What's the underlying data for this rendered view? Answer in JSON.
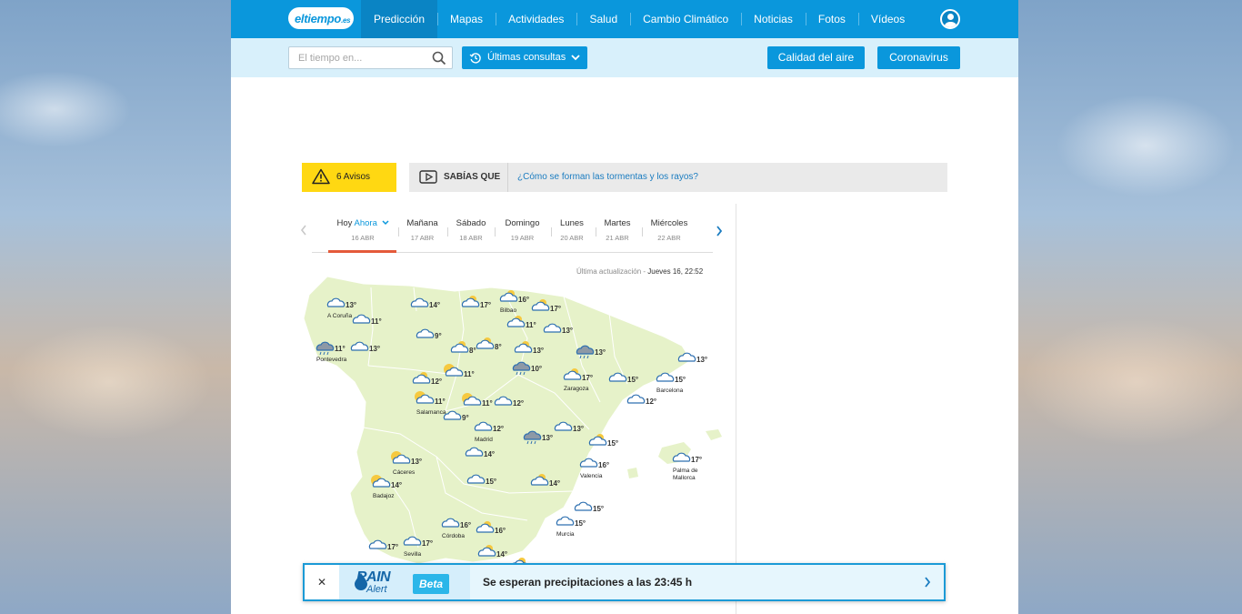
{
  "nav": {
    "logo": {
      "main": "eltiempo",
      "suffix": ".es"
    },
    "items": [
      {
        "label": "Predicción",
        "active": true
      },
      {
        "label": "Mapas"
      },
      {
        "label": "Actividades"
      },
      {
        "label": "Salud"
      },
      {
        "label": "Cambio Climático"
      },
      {
        "label": "Noticias"
      },
      {
        "label": "Fotos"
      },
      {
        "label": "Vídeos"
      }
    ],
    "user_icon": "user-icon"
  },
  "subbar": {
    "search_placeholder": "El tiempo en...",
    "recent_label": "Últimas consultas",
    "air_quality": "Calidad del aire",
    "coronavirus": "Coronavirus"
  },
  "alerts": {
    "avisos_label": "6 Avisos",
    "sabias_tag": "SABÍAS QUE",
    "sabias_link": "¿Cómo se forman las tormentas y los rayos?"
  },
  "days": [
    {
      "name": "Hoy",
      "now": "Ahora",
      "date": "16 ABR",
      "active": true
    },
    {
      "name": "Mañana",
      "date": "17 ABR"
    },
    {
      "name": "Sábado",
      "date": "18 ABR"
    },
    {
      "name": "Domingo",
      "date": "19 ABR"
    },
    {
      "name": "Lunes",
      "date": "20 ABR"
    },
    {
      "name": "Martes",
      "date": "21 ABR"
    },
    {
      "name": "Miércoles",
      "date": "22 ABR"
    }
  ],
  "update": {
    "label": "Última actualización -",
    "value": "Jueves 16, 22:52"
  },
  "map": {
    "colors": {
      "land": "#e6f2c9",
      "border": "#ffffff",
      "sea": "#ffffff"
    },
    "markers": [
      {
        "temp": "13°",
        "city": "A Coruña",
        "icon": "cloud-icon"
      },
      {
        "temp": "14°",
        "icon": "cloud-icon"
      },
      {
        "temp": "17°",
        "icon": "cloud-sun-icon"
      },
      {
        "temp": "16°",
        "city": "Bilbao",
        "icon": "cloud-sun-icon"
      },
      {
        "temp": "17°",
        "icon": "cloud-sun-icon"
      },
      {
        "temp": "11°",
        "icon": "cloud-sun-icon"
      },
      {
        "temp": "11°",
        "icon": "cloud-icon"
      },
      {
        "temp": "13°",
        "icon": "cloud-icon"
      },
      {
        "temp": "9°",
        "icon": "cloud-icon"
      },
      {
        "temp": "11°",
        "city": "Pontevedra",
        "icon": "rain-cloud-icon"
      },
      {
        "temp": "13°",
        "icon": "cloud-icon"
      },
      {
        "temp": "8°",
        "icon": "cloud-sun-icon"
      },
      {
        "temp": "8°",
        "icon": "cloud-sun-icon"
      },
      {
        "temp": "13°",
        "icon": "cloud-sun-icon"
      },
      {
        "temp": "13°",
        "icon": "rain-cloud-icon"
      },
      {
        "temp": "13°",
        "icon": "cloud-icon"
      },
      {
        "temp": "10°",
        "icon": "rain-cloud-icon"
      },
      {
        "temp": "11°",
        "icon": "moon-cloud-icon"
      },
      {
        "temp": "12°",
        "icon": "cloud-sun-icon"
      },
      {
        "temp": "17°",
        "city": "Zaragoza",
        "icon": "cloud-sun-icon"
      },
      {
        "temp": "15°",
        "icon": "cloud-icon"
      },
      {
        "temp": "15°",
        "city": "Barcelona",
        "icon": "cloud-icon"
      },
      {
        "temp": "12°",
        "icon": "cloud-icon"
      },
      {
        "temp": "11°",
        "city": "Salamanca",
        "icon": "moon-cloud-icon"
      },
      {
        "temp": "11°",
        "icon": "moon-cloud-icon"
      },
      {
        "temp": "12°",
        "icon": "cloud-icon"
      },
      {
        "temp": "9°",
        "icon": "cloud-icon"
      },
      {
        "temp": "12°",
        "city": "Madrid",
        "icon": "cloud-icon"
      },
      {
        "temp": "13°",
        "icon": "rain-cloud-icon"
      },
      {
        "temp": "13°",
        "icon": "cloud-icon"
      },
      {
        "temp": "15°",
        "icon": "cloud-sun-icon"
      },
      {
        "temp": "14°",
        "icon": "cloud-icon"
      },
      {
        "temp": "13°",
        "city": "Cáceres",
        "icon": "moon-cloud-icon"
      },
      {
        "temp": "16°",
        "city": "Valencia",
        "icon": "cloud-icon"
      },
      {
        "temp": "17°",
        "city": "Palma de\nMallorca",
        "icon": "cloud-icon"
      },
      {
        "temp": "14°",
        "city": "Badajoz",
        "icon": "moon-cloud-icon"
      },
      {
        "temp": "15°",
        "icon": "cloud-icon"
      },
      {
        "temp": "14°",
        "icon": "cloud-sun-icon"
      },
      {
        "temp": "15°",
        "icon": "cloud-icon"
      },
      {
        "temp": "15°",
        "city": "Murcia",
        "icon": "cloud-icon"
      },
      {
        "temp": "16°",
        "city": "Córdoba",
        "icon": "cloud-icon"
      },
      {
        "temp": "16°",
        "icon": "cloud-sun-icon"
      },
      {
        "temp": "17°",
        "icon": "cloud-icon"
      },
      {
        "temp": "17°",
        "city": "Sevilla",
        "icon": "cloud-icon"
      },
      {
        "temp": "14°",
        "icon": "cloud-sun-icon"
      },
      {
        "temp": "16°",
        "icon": "cloud-sun-icon"
      }
    ]
  },
  "rain_alert": {
    "close": "✕",
    "brand_word": "RAIN",
    "brand_sub": "Alert",
    "beta": "Beta",
    "message": "Se esperan precipitaciones a las 23:45 h"
  }
}
